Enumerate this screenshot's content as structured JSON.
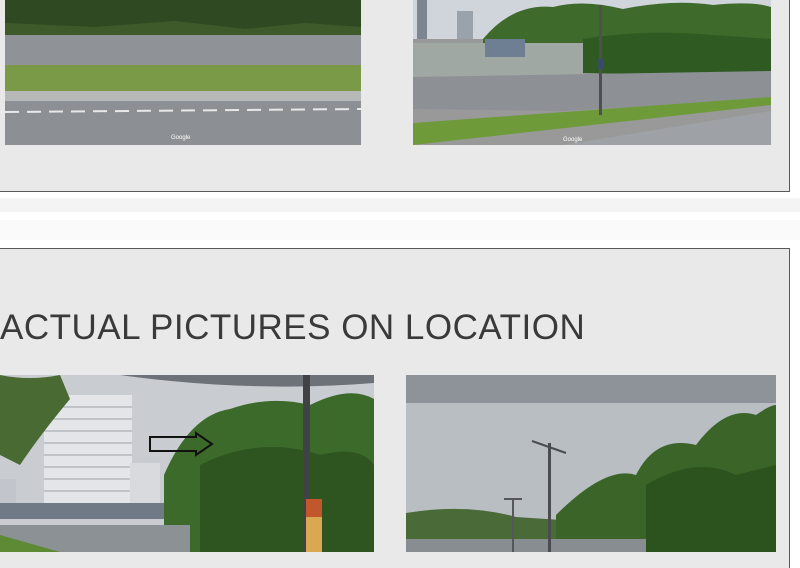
{
  "top_slide": {
    "photos": [
      {
        "scene": "roadside-grass-verge",
        "watermark": "Google"
      },
      {
        "scene": "junction-with-hill",
        "watermark": "Google"
      }
    ]
  },
  "bottom_slide": {
    "heading": "ACTUAL PICTURES ON LOCATION",
    "photos": [
      {
        "scene": "high-rise-and-forested-slope"
      },
      {
        "scene": "road-with-street-light-and-hill"
      }
    ]
  },
  "colors": {
    "slide_bg": "#e9e9e9",
    "slide_border": "#5a5a5a",
    "heading_text": "#3a3a3a"
  }
}
